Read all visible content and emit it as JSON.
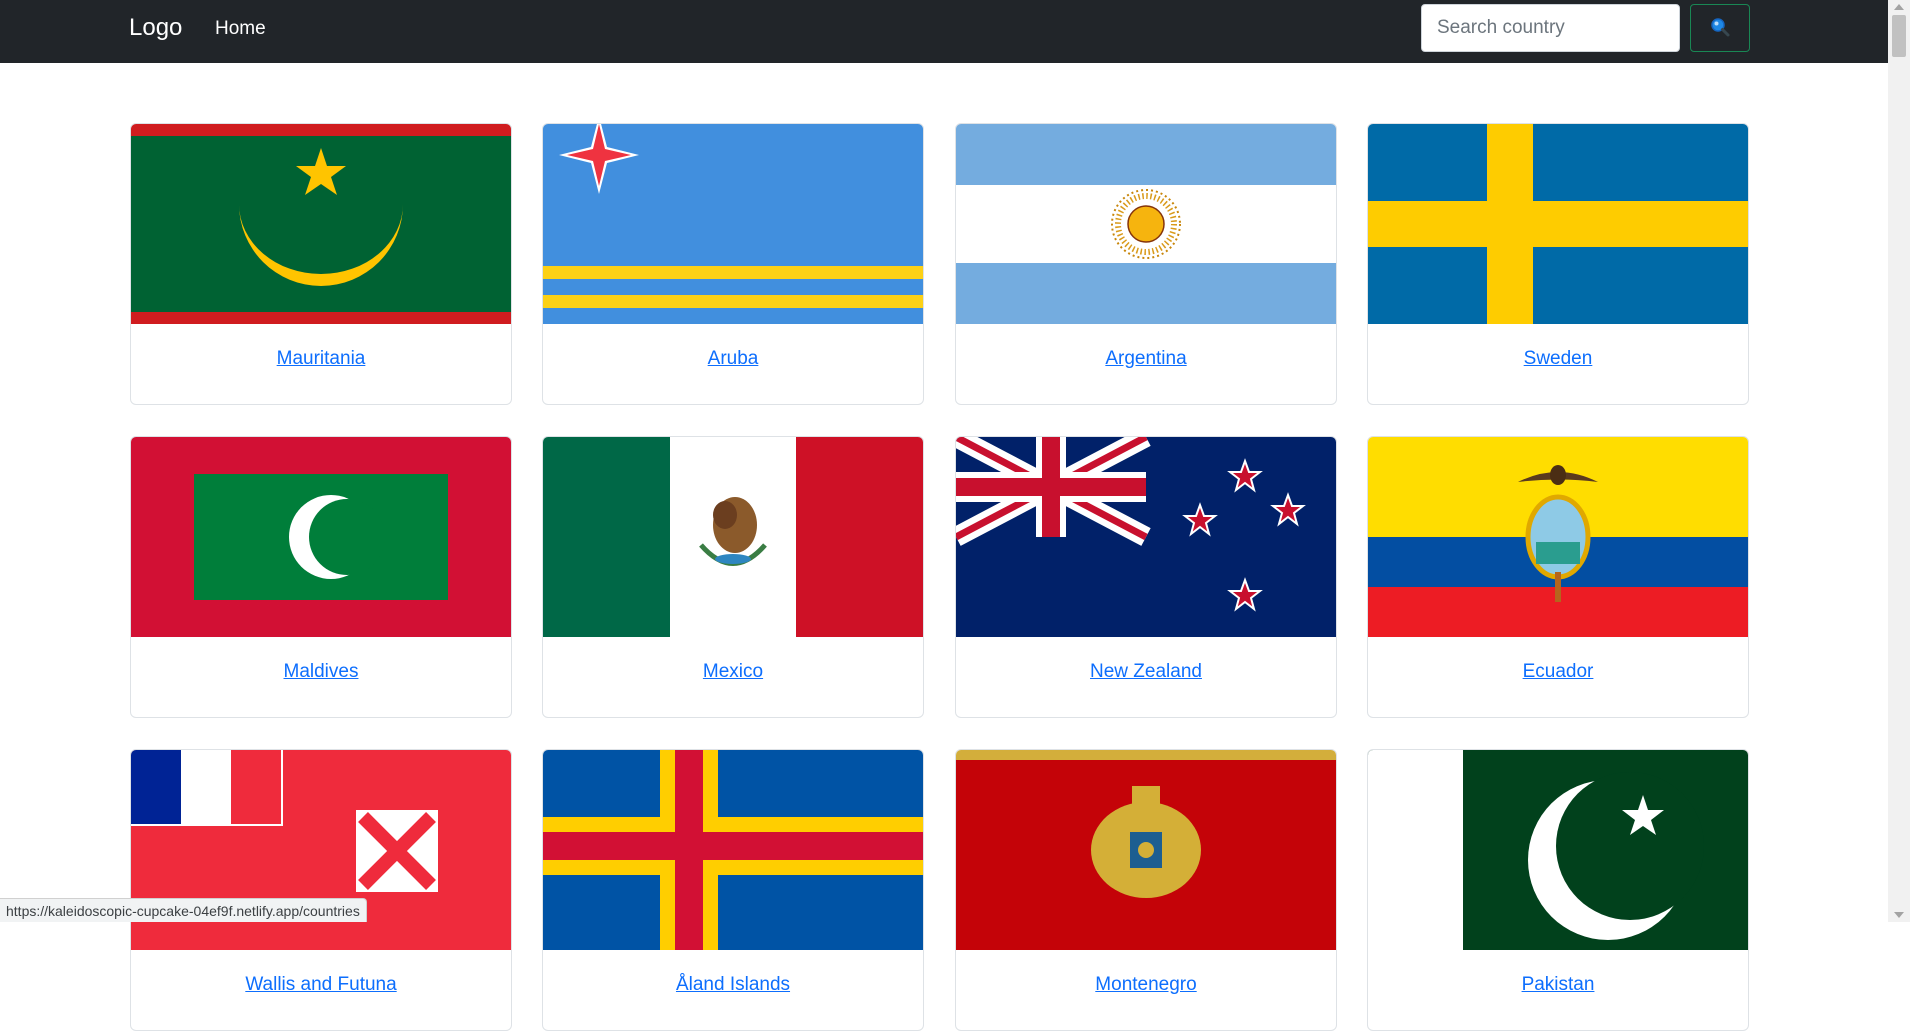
{
  "navbar": {
    "brand": "Logo",
    "home": "Home",
    "search_placeholder": "Search country",
    "search_icon": "magnifier-icon",
    "search_button_color": "#198754"
  },
  "countries": [
    {
      "name": "Mauritania"
    },
    {
      "name": "Aruba"
    },
    {
      "name": "Argentina"
    },
    {
      "name": "Sweden"
    },
    {
      "name": "Maldives"
    },
    {
      "name": "Mexico"
    },
    {
      "name": "New Zealand"
    },
    {
      "name": "Ecuador"
    },
    {
      "name": "Wallis and Futuna"
    },
    {
      "name": "Åland Islands"
    },
    {
      "name": "Montenegro"
    },
    {
      "name": "Pakistan"
    }
  ],
  "status_bar": {
    "url": "https://kaleidoscopic-cupcake-04ef9f.netlify.app/countries"
  },
  "colors": {
    "navbar_bg": "#212529",
    "link": "#0d6efd"
  }
}
